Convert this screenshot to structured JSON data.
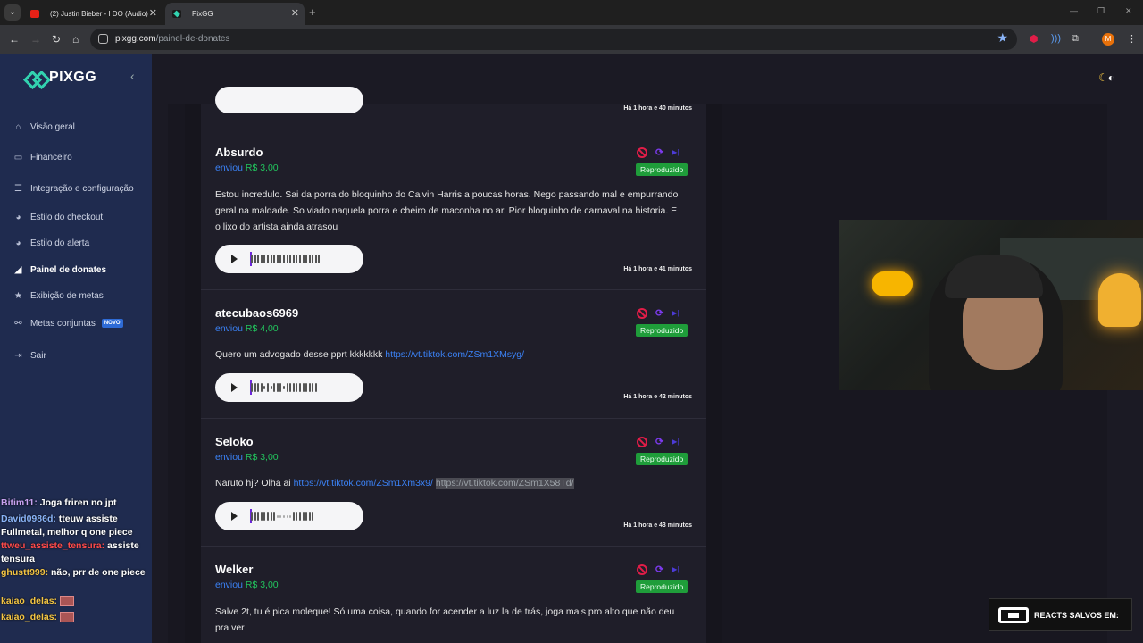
{
  "browser": {
    "tab_menu_icon": "chevron-down-icon",
    "tabs": [
      {
        "title": "(2) Justin Bieber - I DO (Audio)",
        "close": "✕"
      },
      {
        "title": "PixGG",
        "close": "✕"
      }
    ],
    "new_tab": "+",
    "url_host": "pixgg.com",
    "url_path": "/painel-de-donates",
    "window_controls": [
      "—",
      "❐",
      "✕"
    ],
    "profile_initial": "M"
  },
  "sidebar": {
    "logo_text": "PIXGG",
    "items": [
      {
        "label": "Visão geral",
        "icon": "home-icon"
      },
      {
        "label": "Financeiro",
        "icon": "wallet-icon"
      },
      {
        "label": "Integração e configuração",
        "icon": "settings-icon"
      },
      {
        "label": "Estilo do checkout",
        "icon": "palette-icon"
      },
      {
        "label": "Estilo do alerta",
        "icon": "palette-icon"
      },
      {
        "label": "Painel de donates",
        "icon": "megaphone-icon"
      },
      {
        "label": "Exibição de metas",
        "icon": "star-icon"
      },
      {
        "label": "Metas conjuntas",
        "icon": "link-icon",
        "badge": "NOVO"
      },
      {
        "label": "Sair",
        "icon": "logout-icon"
      }
    ]
  },
  "donations": [
    {
      "time": "Há 1 hora e 40 minutos"
    },
    {
      "name": "Absurdo",
      "sent": "enviou",
      "amount": "R$ 3,00",
      "status": "Reproduzido",
      "message": "Estou incredulo. Sai da porra do bloquinho do Calvin Harris a poucas horas. Nego passando mal e empurrando geral na maldade. So viado naquela porra e cheiro de maconha no ar. Pior bloquinho de carnaval na historia. E o lixo do artista ainda atrasou",
      "time": "Há 1 hora e 41 minutos"
    },
    {
      "name": "atecubaos6969",
      "sent": "enviou",
      "amount": "R$ 4,00",
      "status": "Reproduzido",
      "message": "Quero um advogado desse pprt kkkkkkk ",
      "link": "https://vt.tiktok.com/ZSm1XMsyg/",
      "time": "Há 1 hora e 42 minutos"
    },
    {
      "name": "Seloko",
      "sent": "enviou",
      "amount": "R$ 3,00",
      "status": "Reproduzido",
      "message": "Naruto hj? Olha ai ",
      "link": "https://vt.tiktok.com/ZSm1Xm3x9/",
      "link2": "https://vt.tiktok.com/ZSm1X58Td/",
      "time": "Há 1 hora e 43 minutos"
    },
    {
      "name": "Welker",
      "sent": "enviou",
      "amount": "R$ 3,00",
      "status": "Reproduzido",
      "message": "Salve 2t, tu é pica moleque! Só uma coisa, quando for acender a luz la de trás, joga mais pro alto que não deu pra ver"
    }
  ],
  "chat": [
    {
      "user": "Bitim11:",
      "text": " Joga friren no jpt"
    },
    {
      "user": "David0986d:",
      "text": " tteuw assiste Fullmetal, melhor q one piece"
    },
    {
      "user": "ttweu_assiste_tensura:",
      "text": " assiste tensura"
    },
    {
      "user": "ghustt999:",
      "text": " não, prr de one piece"
    },
    {
      "user": "kaiao_delas:",
      "text": ""
    },
    {
      "user": "kaiao_delas:",
      "text": ""
    }
  ],
  "overlay": {
    "reacts_label": "REACTS SALVOS EM:"
  },
  "colors": {
    "sidebar": "#1f2b4f",
    "accent": "#32d3b0",
    "link": "#3b82f6",
    "amount": "#22c55e",
    "status": "#1f9d3a"
  }
}
